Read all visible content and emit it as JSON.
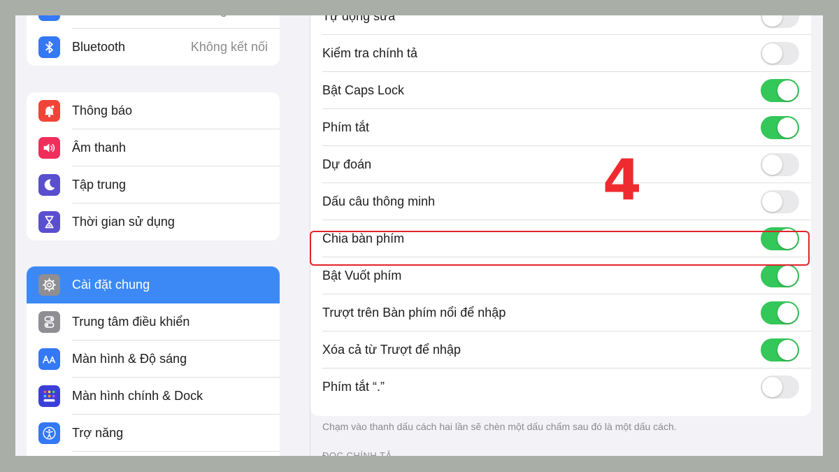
{
  "sidebar": {
    "group1": [
      {
        "label": "Wi-Fi",
        "value": "Không kết nối",
        "icon": "wifi-icon",
        "color": "#3478f6"
      },
      {
        "label": "Bluetooth",
        "value": "Không kết nối",
        "icon": "bluetooth-icon",
        "color": "#3478f6"
      }
    ],
    "group2": [
      {
        "label": "Thông báo",
        "icon": "notifications-icon",
        "color": "#f04438"
      },
      {
        "label": "Âm thanh",
        "icon": "sound-icon",
        "color": "#f02e5b"
      },
      {
        "label": "Tập trung",
        "icon": "moon-icon",
        "color": "#5a4fcf"
      },
      {
        "label": "Thời gian sử dụng",
        "icon": "hourglass-icon",
        "color": "#5a4fcf"
      }
    ],
    "group3": [
      {
        "label": "Cài đặt chung",
        "icon": "gear-icon",
        "color": "#8e8e93",
        "selected": true
      },
      {
        "label": "Trung tâm điều khiển",
        "icon": "toggles-icon",
        "color": "#8e8e93"
      },
      {
        "label": "Màn hình & Độ sáng",
        "icon": "text-size-icon",
        "color": "#3478f6"
      },
      {
        "label": "Màn hình chính & Dock",
        "icon": "home-grid-icon",
        "color": "#3478f6"
      },
      {
        "label": "Trợ năng",
        "icon": "accessibility-icon",
        "color": "#3478f6"
      }
    ]
  },
  "settings": [
    {
      "label": "Tự động sửa",
      "on": false
    },
    {
      "label": "Kiểm tra chính tả",
      "on": false
    },
    {
      "label": "Bật Caps Lock",
      "on": true
    },
    {
      "label": "Phím tắt",
      "on": true
    },
    {
      "label": "Dự đoán",
      "on": false
    },
    {
      "label": "Dấu câu thông minh",
      "on": false
    },
    {
      "label": "Chia bàn phím",
      "on": true
    },
    {
      "label": "Bật Vuốt phím",
      "on": true
    },
    {
      "label": "Trượt trên Bàn phím nổi để nhập",
      "on": true
    },
    {
      "label": "Xóa cả từ Trượt để nhập",
      "on": true
    },
    {
      "label": "Phím tắt “.”",
      "on": false
    }
  ],
  "footnote": "Chạm vào thanh dấu cách hai lần sẽ chèn một dấu chấm sau đó là một dấu cách.",
  "next_section": "ĐỌC CHÍNH TẢ",
  "annotation": {
    "step": "4",
    "color": "#e2232a"
  }
}
